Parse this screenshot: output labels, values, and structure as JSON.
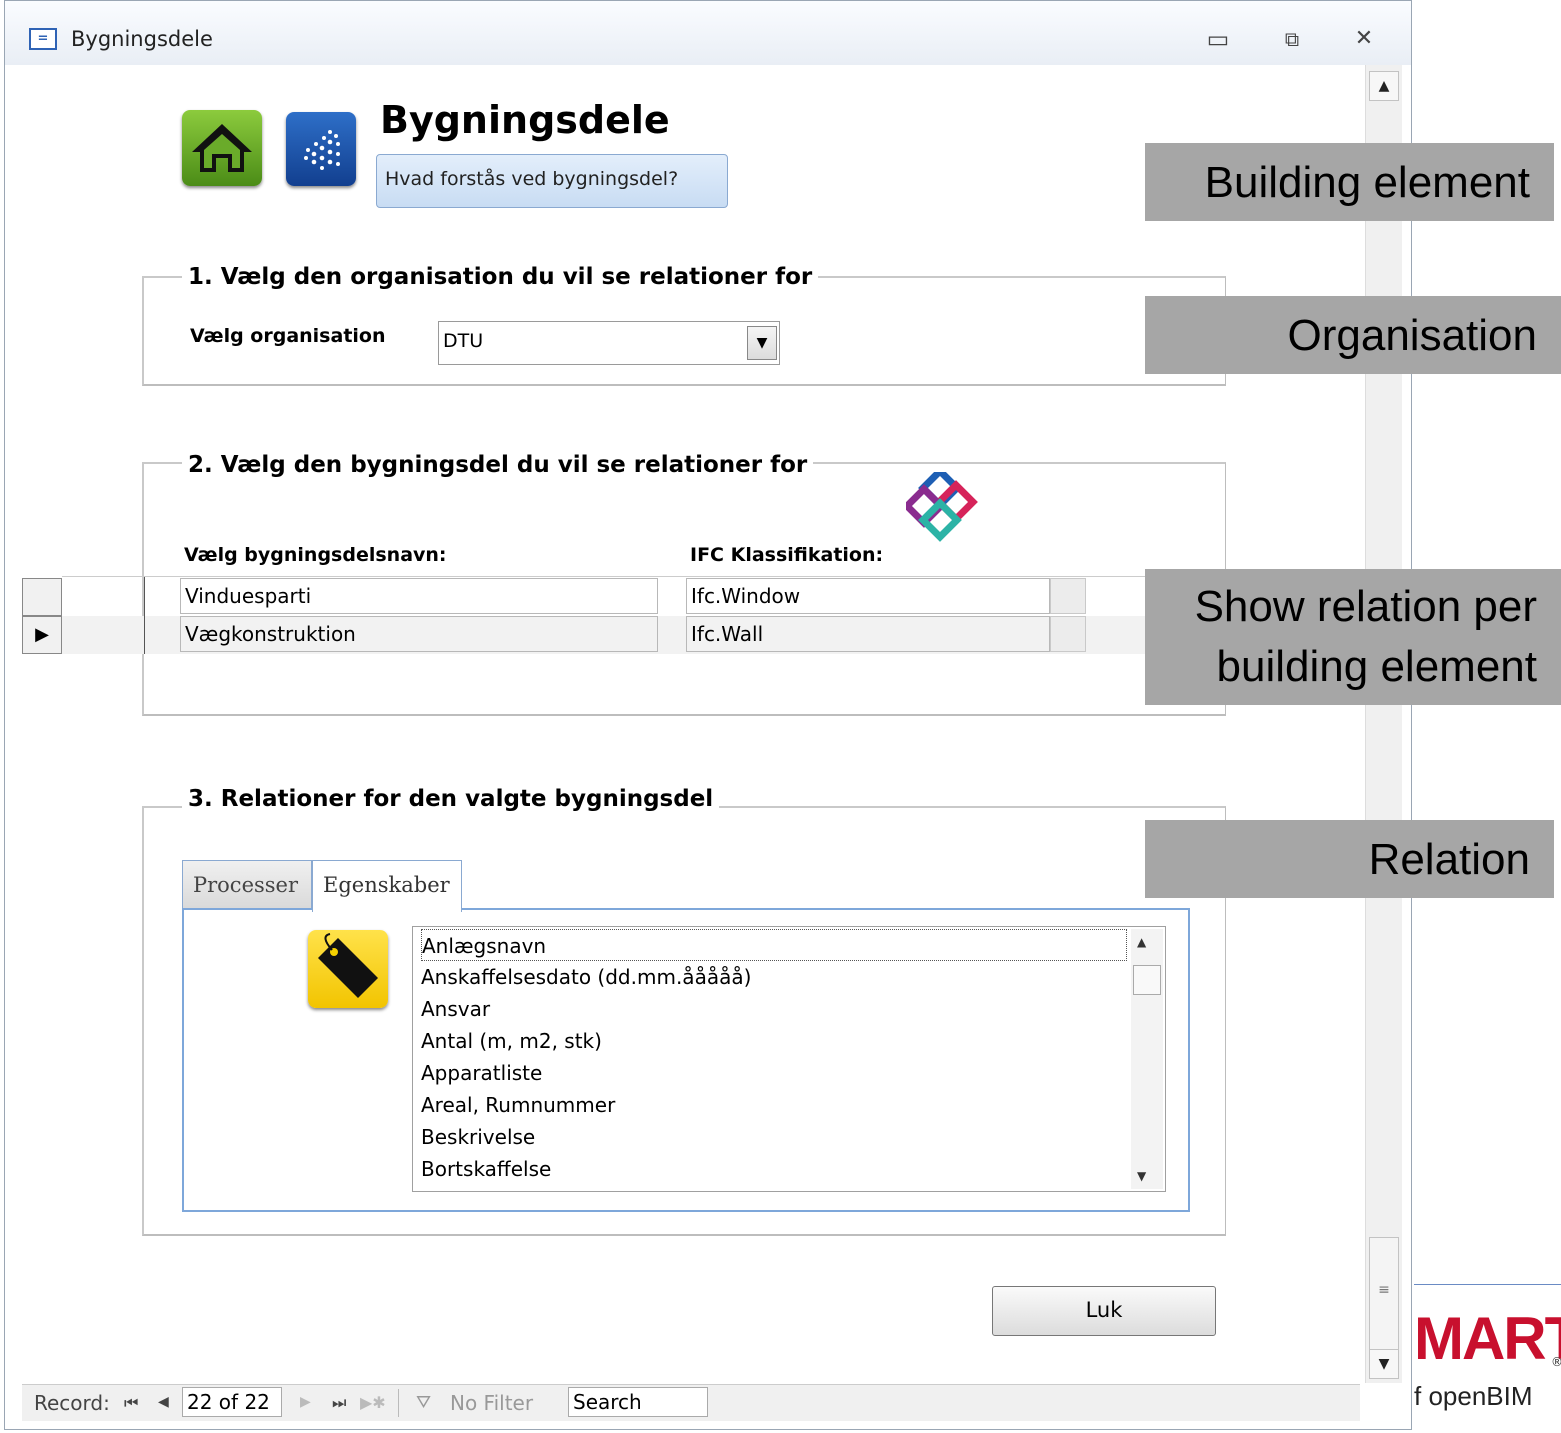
{
  "window": {
    "title": "Bygningsdele",
    "controls": {
      "minimize": "▭",
      "restore": "⧉",
      "close": "✕"
    }
  },
  "header": {
    "heading": "Bygningsdele",
    "help_button": "Hvad forstås ved bygningsdel?"
  },
  "section1": {
    "legend": "1. Vælg den organisation du vil se relationer for",
    "label": "Vælg organisation",
    "combo_value": "DTU"
  },
  "section2": {
    "legend": "2. Vælg den bygningsdel du vil se relationer for",
    "col_name": "Vælg bygningsdelsnavn:",
    "col_ifc": "IFC Klassifikation:",
    "rows": [
      {
        "name": "Vinduesparti",
        "ifc": "Ifc.Window"
      },
      {
        "name": "Vægkonstruktion",
        "ifc": "Ifc.Wall"
      }
    ]
  },
  "section3": {
    "legend": "3. Relationer for den valgte bygningsdel",
    "tabs": [
      "Processer",
      "Egenskaber"
    ],
    "active_tab": "Egenskaber",
    "items": [
      "Anlægsnavn",
      "Anskaffelsesdato (dd.mm.ååååå)",
      "Ansvar",
      "Antal (m, m2, stk)",
      "Apparatliste",
      "Areal, Rumnummer",
      "Beskrivelse",
      "Bortskaffelse"
    ]
  },
  "close_button": "Luk",
  "navbar": {
    "record_label": "Record:",
    "position": "22 of 22",
    "filter": "No Filter",
    "search": "Search"
  },
  "annotations": {
    "building_element": "Building element",
    "organisation": "Organisation",
    "show_relation_line1": "Show relation per",
    "show_relation_line2": "building element",
    "relation": "Relation"
  },
  "logo": {
    "text_big": "MART",
    "text_small": "f openBIM",
    "registered": "®"
  },
  "colors": {
    "annotation_bg": "#a6a6a6",
    "tab_border": "#7ea7da",
    "logo_red": "#c8102e",
    "home_icon_green": "#6aab2a",
    "app_icon_blue": "#1f56a8",
    "tag_icon_yellow": "#f6d100"
  }
}
